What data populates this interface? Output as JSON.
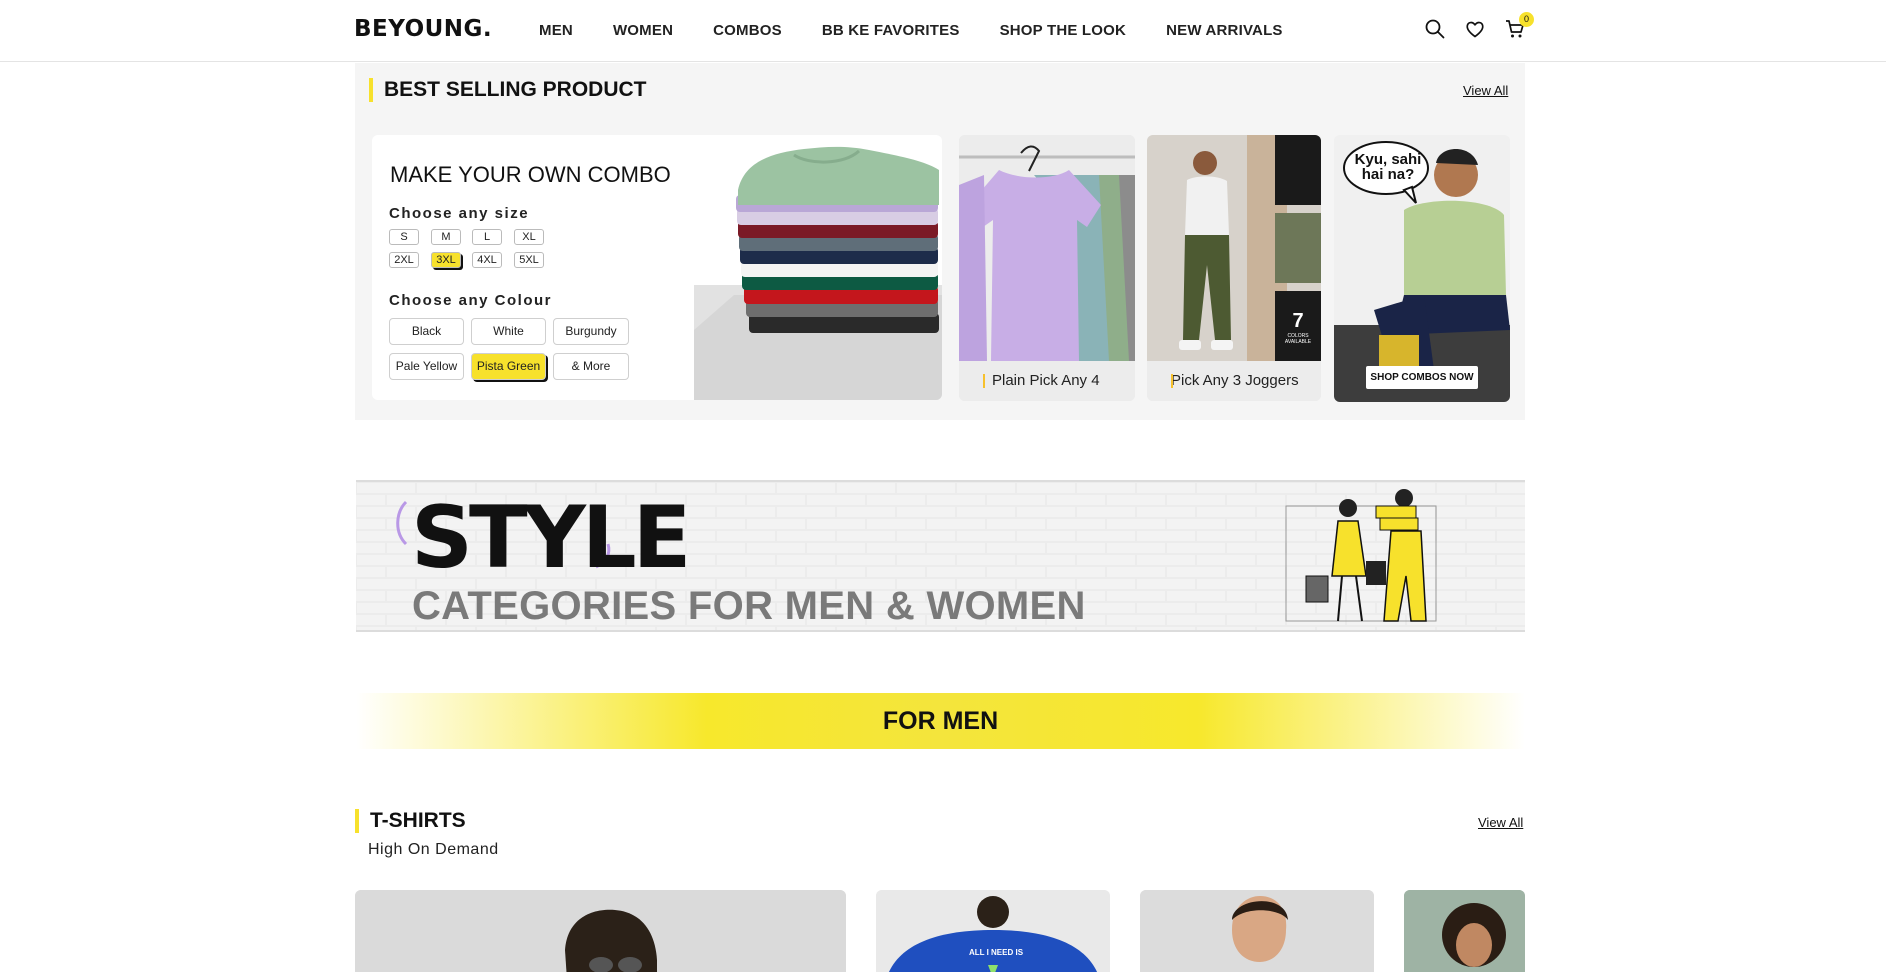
{
  "header": {
    "logo": "BEYOUNG.",
    "nav": [
      "MEN",
      "WOMEN",
      "COMBOS",
      "BB KE FAVORITES",
      "SHOP THE LOOK",
      "NEW ARRIVALS"
    ],
    "icons": [
      "search-icon",
      "heart-icon",
      "cart-icon"
    ],
    "cart_count": "0"
  },
  "best_selling": {
    "title": "BEST SELLING PRODUCT",
    "view_all": "View All",
    "combo": {
      "title": "MAKE YOUR OWN COMBO",
      "size_label": "Choose any size",
      "sizes": [
        "S",
        "M",
        "L",
        "XL",
        "2XL",
        "3XL",
        "4XL",
        "5XL"
      ],
      "selected_size": "3XL",
      "colour_label": "Choose any Colour",
      "colours": [
        "Black",
        "White",
        "Burgundy",
        "Pale Yellow",
        "Pista Green",
        "& More"
      ],
      "selected_colour": "Pista Green"
    },
    "tiles": [
      {
        "label": "Plain Pick Any 4"
      },
      {
        "label": "Pick Any 3 Joggers",
        "badge_number": "7",
        "badge_text": "COLORS AVAILABLE"
      },
      {
        "speech": "Kyu, sahi hai na?",
        "button": "SHOP COMBOS NOW"
      }
    ]
  },
  "style_banner": {
    "word": "STYLE",
    "subtitle": "CATEGORIES FOR MEN & WOMEN"
  },
  "for_men": "FOR MEN",
  "tshirts": {
    "title": "T-SHIRTS",
    "subtitle": "High On Demand",
    "view_all": "View All",
    "print_text": "ALL I NEED IS"
  },
  "colors": {
    "accent": "#f7e12c",
    "section_bg": "#f5f5f5"
  }
}
